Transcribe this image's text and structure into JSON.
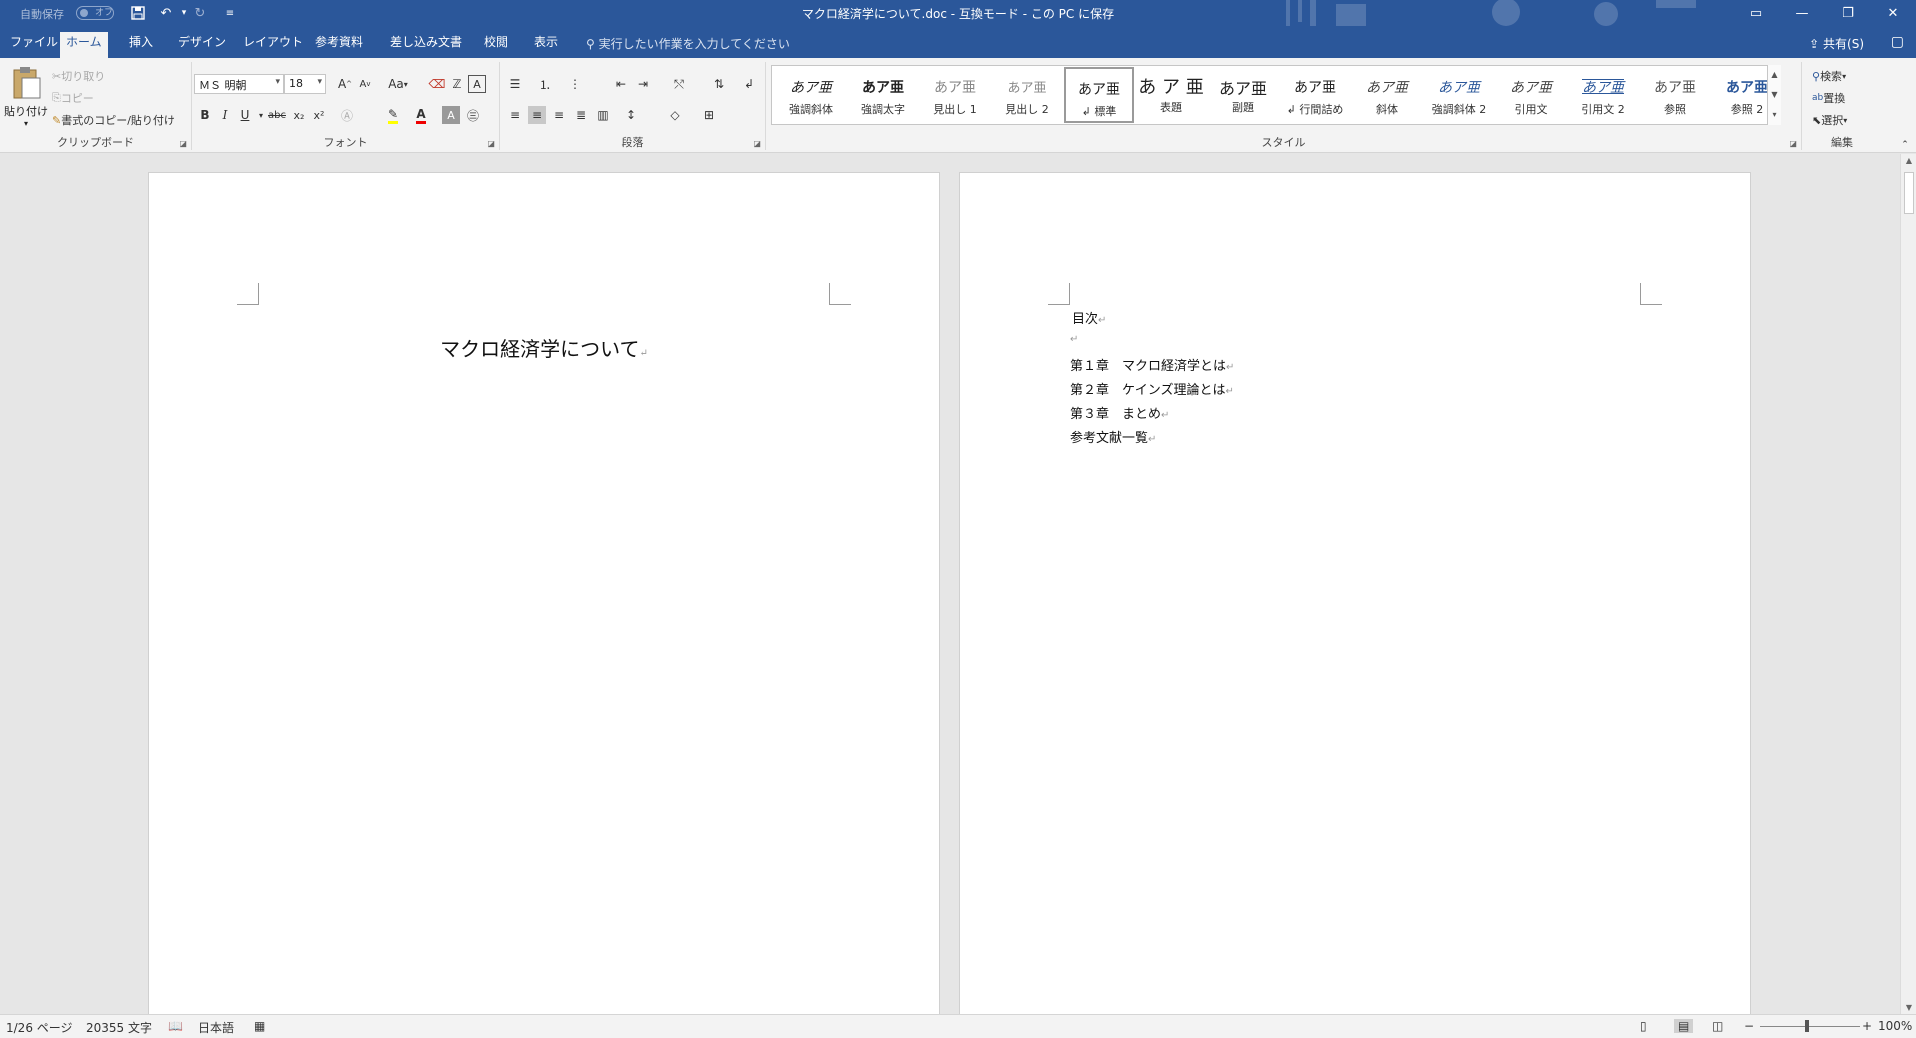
{
  "titlebar": {
    "autosave_label": "自動保存",
    "autosave_state": "オフ",
    "qat_save": "save-icon",
    "qat_undo": "undo-icon",
    "qat_redo": "redo-icon",
    "document_title": "マクロ経済学について.doc  -  互換モード - この PC に保存",
    "window_buttons": [
      "ribbon-display-icon",
      "minimize-icon",
      "restore-icon",
      "close-icon"
    ]
  },
  "tabs": [
    "ファイル",
    "ホーム",
    "挿入",
    "デザイン",
    "レイアウト",
    "参考資料",
    "差し込み文書",
    "校閲",
    "表示"
  ],
  "active_tab": "ホーム",
  "tell_me": "実行したい作業を入力してください",
  "share_label": "共有(S)",
  "ribbon": {
    "clipboard": {
      "label": "クリップボード",
      "paste": "貼り付け",
      "cut": "切り取り",
      "copy": "コピー",
      "format_painter": "書式のコピー/貼り付け"
    },
    "font": {
      "label": "フォント",
      "font_name": "ＭＳ 明朝",
      "font_size": "18",
      "change_case": "Aa",
      "bold": "B",
      "italic": "I",
      "underline": "U",
      "strike": "abc",
      "subscript": "x₂",
      "superscript": "x²"
    },
    "paragraph": {
      "label": "段落"
    },
    "styles": {
      "label": "スタイル",
      "items": [
        {
          "sample": "あア亜",
          "name": "強調斜体"
        },
        {
          "sample": "あア亜",
          "name": "強調太字"
        },
        {
          "sample": "あア亜",
          "name": "見出し 1"
        },
        {
          "sample": "あア亜",
          "name": "見出し 2"
        },
        {
          "sample": "あア亜",
          "name": "↲ 標準"
        },
        {
          "sample": "あ ア 亜",
          "name": "表題"
        },
        {
          "sample": "あア亜",
          "name": "副題"
        },
        {
          "sample": "あア亜",
          "name": "↲ 行間詰め"
        },
        {
          "sample": "あア亜",
          "name": "斜体"
        },
        {
          "sample": "あア亜",
          "name": "強調斜体 2"
        },
        {
          "sample": "あア亜",
          "name": "引用文"
        },
        {
          "sample": "あア亜",
          "name": "引用文 2"
        },
        {
          "sample": "あア亜",
          "name": "参照"
        },
        {
          "sample": "あア亜",
          "name": "参照 2"
        }
      ],
      "selected": "↲ 標準"
    },
    "editing": {
      "label": "編集",
      "find": "検索",
      "replace": "置換",
      "select": "選択"
    }
  },
  "pages": {
    "page1_title": "マクロ経済学について",
    "toc": [
      "目次",
      "",
      "第１章　マクロ経済学とは",
      "第２章　ケインズ理論とは",
      "第３章　まとめ",
      "参考文献一覧"
    ]
  },
  "status": {
    "page": "1/26 ページ",
    "words": "20355 文字",
    "language": "日本語",
    "zoom": "100%",
    "zoom_minus": "−",
    "zoom_plus": "+"
  },
  "colors": {
    "brand": "#2b579a",
    "ribbon": "#f3f3f3",
    "canvas": "#e6e6e6"
  }
}
